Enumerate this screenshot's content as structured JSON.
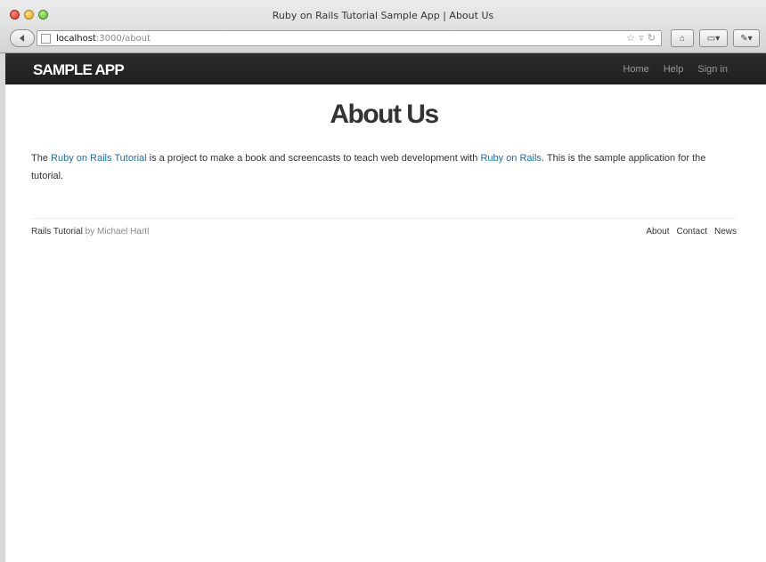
{
  "window": {
    "title": "Ruby on Rails Tutorial Sample App | About Us",
    "url_host": "localhost",
    "url_path": ":3000/about"
  },
  "navbar": {
    "logo": "SAMPLE APP",
    "links": [
      "Home",
      "Help",
      "Sign in"
    ]
  },
  "main": {
    "heading": "About Us",
    "para_prefix": "The ",
    "link1": "Ruby on Rails Tutorial",
    "para_middle": " is a project to make a book and screencasts to teach web development with ",
    "link2": "Ruby on Rails",
    "para_suffix": ". This is the sample application for the tutorial."
  },
  "footer": {
    "brand": "Rails Tutorial",
    "by": " by ",
    "author": "Michael Hartl",
    "links": [
      "About",
      "Contact",
      "News"
    ]
  },
  "colors": {
    "navbar": "#222222",
    "link": "#1a6fb3",
    "text": "#333333"
  },
  "icons": [
    "back-arrow-icon",
    "page-icon",
    "bookmark-star-icon",
    "reload-icon",
    "home-icon",
    "sidebar-icon",
    "extensions-icon"
  ]
}
